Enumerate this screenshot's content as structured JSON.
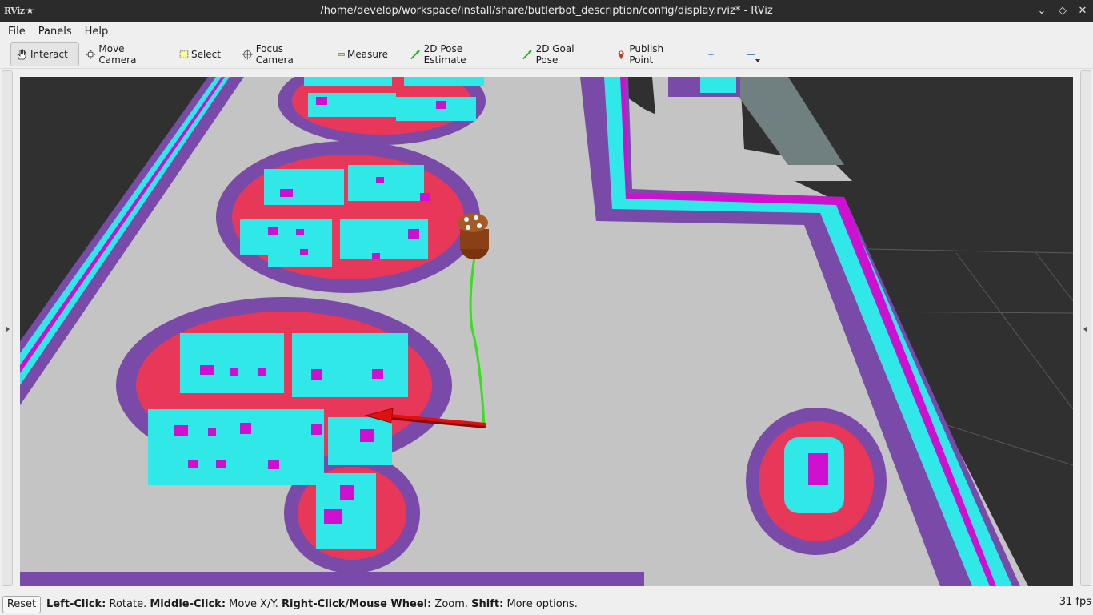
{
  "window": {
    "logo": "RViz",
    "title": "/home/develop/workspace/install/share/butlerbot_description/config/display.rviz* - RViz"
  },
  "menu": [
    "File",
    "Panels",
    "Help"
  ],
  "toolbar": {
    "tools": [
      {
        "label": "Interact",
        "icon": "hand-icon",
        "active": true
      },
      {
        "label": "Move Camera",
        "icon": "move-camera-icon"
      },
      {
        "label": "Select",
        "icon": "select-box-icon"
      },
      {
        "label": "Focus Camera",
        "icon": "focus-target-icon"
      },
      {
        "label": "Measure",
        "icon": "ruler-icon"
      },
      {
        "label": "2D Pose Estimate",
        "icon": "green-arrow-icon"
      },
      {
        "label": "2D Goal Pose",
        "icon": "green-arrow-icon"
      },
      {
        "label": "Publish Point",
        "icon": "map-pin-icon"
      }
    ]
  },
  "status": {
    "reset_label": "Reset",
    "hint": [
      {
        "key": "Left-Click:",
        "text": " Rotate. "
      },
      {
        "key": "Middle-Click:",
        "text": " Move X/Y. "
      },
      {
        "key": "Right-Click/Mouse Wheel:",
        "text": " Zoom. "
      },
      {
        "key": "Shift:",
        "text": " More options."
      }
    ],
    "fps": "31 fps"
  },
  "colors": {
    "free_space": "#c4c4c4",
    "inflation_outer": "#7a4aa8",
    "inflation_inner": "#e8385a",
    "lethal": "#30e8e8",
    "obstacle": "#d010d0",
    "path": "#33e01a",
    "goal_arrow": "#e01010",
    "background": "#303030"
  }
}
